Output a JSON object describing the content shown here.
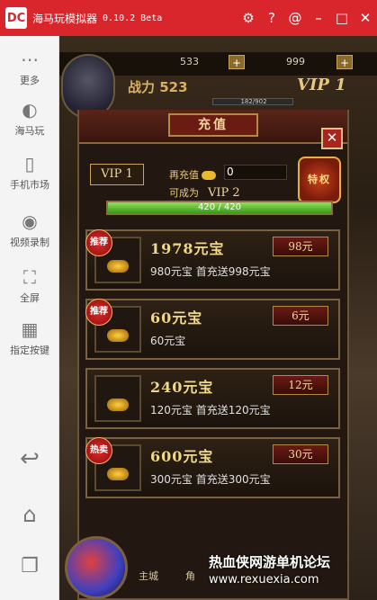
{
  "titlebar": {
    "logo": "DC",
    "title": "海马玩模拟器",
    "version": "0.10.2 Beta",
    "icons": [
      "gear-icon",
      "help-icon",
      "at-icon",
      "minimize-icon",
      "maximize-icon",
      "close-icon"
    ]
  },
  "sidebar": {
    "items": [
      {
        "label": "更多",
        "icon": "more-icon"
      },
      {
        "label": "海马玩",
        "icon": "haima-icon"
      },
      {
        "label": "手机市场",
        "icon": "market-icon"
      },
      {
        "label": "视频录制",
        "icon": "video-icon"
      },
      {
        "label": "全屏",
        "icon": "fullscreen-icon"
      },
      {
        "label": "指定按键",
        "icon": "keymap-icon"
      }
    ],
    "nav": [
      {
        "icon": "back-icon"
      },
      {
        "icon": "home-icon"
      },
      {
        "icon": "recent-apps-icon"
      }
    ]
  },
  "game": {
    "resource1": "533",
    "resource2": "999",
    "plus": "+",
    "power": "战力 523",
    "vip_level": "VIP 1",
    "hp_text": "182/902",
    "dialog": {
      "title": "充值",
      "close": "✕",
      "vip_badge": "VIP 1",
      "recharge_more": "再充值",
      "recharge_amount": "0",
      "become": "可成为",
      "become_vip": "VIP 2",
      "privilege": "特权",
      "progress_text": "420 / 420",
      "progress_fraction": 1.0
    },
    "items": [
      {
        "name": "1978元宝",
        "price": "98元",
        "desc": "980元宝 首充送998元宝",
        "tag": "推荐"
      },
      {
        "name": "60元宝",
        "price": "6元",
        "desc": "60元宝",
        "tag": "推荐"
      },
      {
        "name": "240元宝",
        "price": "12元",
        "desc": "120元宝 首充送120元宝",
        "tag": ""
      },
      {
        "name": "600元宝",
        "price": "30元",
        "desc": "300元宝 首充送300元宝",
        "tag": "热卖"
      }
    ],
    "bottom": {
      "main_city": "主城",
      "role": "角"
    }
  },
  "watermark": {
    "line1": "热血侠网游单机论坛",
    "line2": "www.rexuexia.com"
  }
}
